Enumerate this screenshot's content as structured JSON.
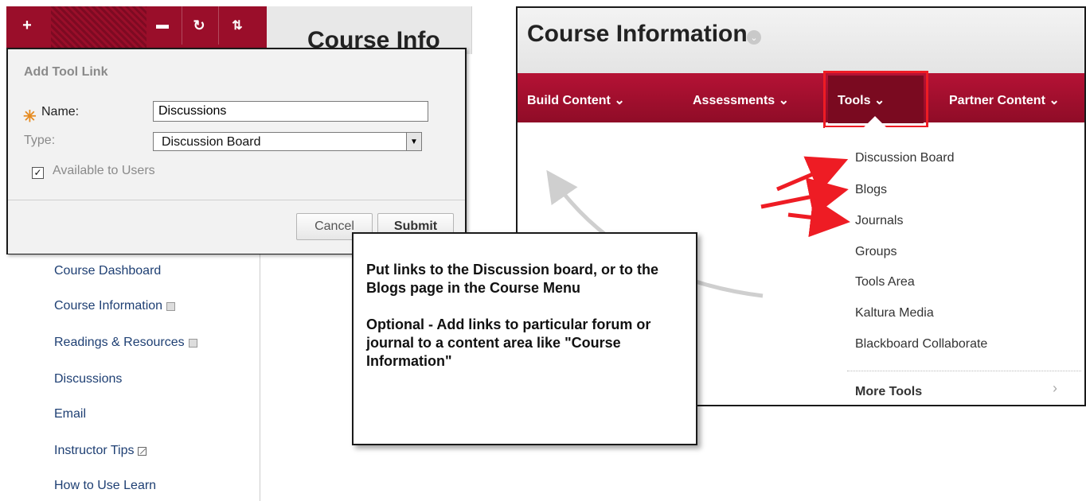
{
  "colors": {
    "brand_red": "#9a0e2a",
    "arrow_red": "#ee1c24",
    "link_blue": "#1e3f73"
  },
  "left_panel": {
    "header_title": "Course Info",
    "toolbar": {
      "add_icon": "plus-icon",
      "folder_icon": "folder-icon",
      "refresh_icon": "refresh-icon",
      "sort_icon": "sort-icon"
    },
    "dialog": {
      "title": "Add Tool Link",
      "name_label": "Name:",
      "name_value": "Discussions",
      "type_label": "Type:",
      "type_value": "Discussion Board",
      "available_label": "Available to Users",
      "available_checked": true,
      "cancel_label": "Cancel",
      "submit_label": "Submit"
    },
    "course_menu": [
      {
        "label": "Course Dashboard",
        "icon": ""
      },
      {
        "label": "Course Information",
        "icon": "content-area-icon"
      },
      {
        "label": "Readings & Resources",
        "icon": "content-area-icon"
      },
      {
        "label": "Discussions",
        "icon": ""
      },
      {
        "label": "Email",
        "icon": ""
      },
      {
        "label": "Instructor Tips",
        "icon": "edit-icon"
      },
      {
        "label": "How to Use Learn",
        "icon": ""
      }
    ]
  },
  "right_panel": {
    "title": "Course Information",
    "nav": [
      {
        "label": "Build Content ⌄"
      },
      {
        "label": "Assessments ⌄"
      },
      {
        "label": "Tools ⌄"
      },
      {
        "label": "Partner Content ⌄"
      }
    ],
    "tools_menu": [
      "Discussion Board",
      "Blogs",
      "Journals",
      "Groups",
      "Tools Area",
      "Kaltura Media",
      "Blackboard Collaborate"
    ],
    "more_tools": "More Tools"
  },
  "callout": {
    "text": "Put links to the Discussion board, or to the Blogs page in the Course Menu\n\nOptional - Add links to particular forum or journal to a content area like \"Course Information\""
  }
}
